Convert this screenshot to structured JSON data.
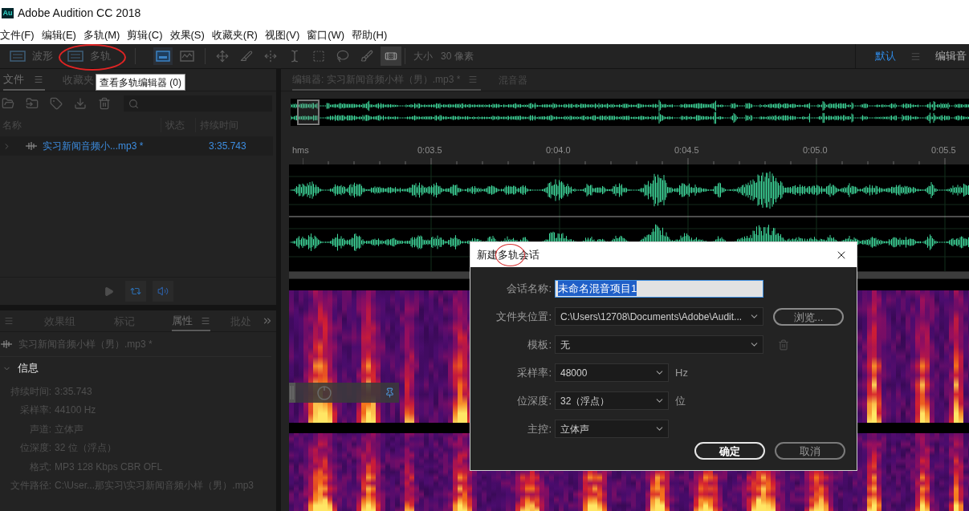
{
  "window": {
    "logo": "Au",
    "title": "Adobe Audition CC 2018"
  },
  "menu": [
    "文件(F)",
    "编辑(E)",
    "多轨(M)",
    "剪辑(C)",
    "效果(S)",
    "收藏夹(R)",
    "视图(V)",
    "窗口(W)",
    "帮助(H)"
  ],
  "toolbar": {
    "view_buttons": [
      {
        "label": "波形",
        "selected": false
      },
      {
        "label": "多轨",
        "selected": false
      }
    ],
    "display_toggles": [
      {
        "kind": "spectral",
        "selected": true
      },
      {
        "kind": "pitch",
        "selected": false
      }
    ],
    "tools": [
      {
        "kind": "move",
        "selected": false
      },
      {
        "kind": "razor",
        "selected": false
      },
      {
        "kind": "slip",
        "selected": false
      },
      {
        "kind": "time_select",
        "selected": false
      },
      {
        "kind": "marquee",
        "selected": false
      },
      {
        "kind": "lasso",
        "selected": false
      },
      {
        "kind": "brush",
        "selected": false
      },
      {
        "kind": "spot_heal",
        "selected": true
      }
    ],
    "brush_size": {
      "label": "大小",
      "value": "30 像素"
    },
    "workspaces": [
      {
        "label": "默认",
        "selected": true
      },
      {
        "label": "编辑音",
        "selected": false
      }
    ]
  },
  "tooltip": "查看多轨编辑器 (0)",
  "files_panel": {
    "tabs": [
      {
        "label": "文件",
        "selected": true
      },
      {
        "label": "收藏夹",
        "selected": false
      }
    ],
    "columns": [
      "名称",
      "状态",
      "持续时间"
    ],
    "rows": [
      {
        "name": "实习新闻音频小...mp3 *",
        "duration": "3:35.743",
        "expanded": false
      }
    ]
  },
  "properties_panel": {
    "tabs": [
      {
        "label": "效果组",
        "selected": false
      },
      {
        "label": "标记",
        "selected": false
      },
      {
        "label": "属性",
        "selected": true
      },
      {
        "label": "批处",
        "selected": false
      }
    ],
    "file": "实习新闻音频小样（男）.mp3 *",
    "section": {
      "title": "信息",
      "expanded": true
    },
    "fields": [
      {
        "label": "持续时间:",
        "value": "3:35.743"
      },
      {
        "label": "采样率:",
        "value": "44100 Hz"
      },
      {
        "label": "声道:",
        "value": "立体声"
      },
      {
        "label": "位深度:",
        "value": "32 位（浮点）"
      },
      {
        "label": "格式:",
        "value": "MP3 128 Kbps CBR OFL"
      },
      {
        "label": "文件路径:",
        "value": "C:\\User...那实习\\实习新闻音频小样（男）.mp3"
      }
    ]
  },
  "editor": {
    "tabs": [
      {
        "label": "编辑器: 实习新闻音频小样（男）.mp3 *",
        "selected": true
      },
      {
        "label": "混音器",
        "selected": false
      }
    ],
    "ruler": {
      "unit": "hms",
      "labels": [
        "0:03.5",
        "0:04.0",
        "0:04.5",
        "0:05.0",
        "0:05.5"
      ]
    }
  },
  "dialog": {
    "title": "新建多轨会话",
    "fields": [
      {
        "kind": "text",
        "label": "会话名称:",
        "value": "未命名混音项目1",
        "text_selected": true
      },
      {
        "kind": "select",
        "label": "文件夹位置:",
        "value": "C:\\Users\\12708\\Documents\\Adobe\\Audit...",
        "button": "浏览..."
      },
      {
        "kind": "select",
        "label": "模板:",
        "value": "无",
        "trash_disabled": true
      },
      {
        "kind": "select",
        "label": "采样率:",
        "value": "48000",
        "unit": "Hz"
      },
      {
        "kind": "select",
        "label": "位深度:",
        "value": "32（浮点）",
        "unit": "位"
      },
      {
        "kind": "select",
        "label": "主控:",
        "value": "立体声"
      }
    ],
    "buttons": [
      {
        "label": "确定",
        "primary": true
      },
      {
        "label": "取消",
        "primary": false
      }
    ]
  }
}
